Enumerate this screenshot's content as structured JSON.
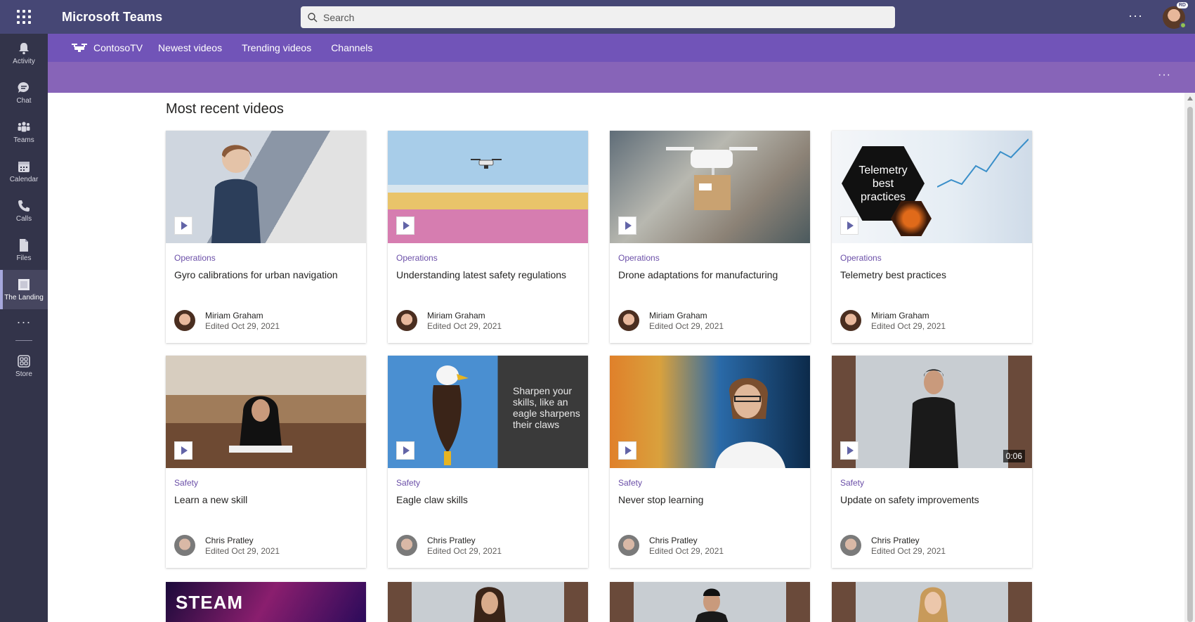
{
  "app": {
    "title": "Microsoft Teams"
  },
  "search": {
    "placeholder": "Search"
  },
  "rail": [
    {
      "label": "Activity",
      "icon": "bell-icon"
    },
    {
      "label": "Chat",
      "icon": "chat-icon"
    },
    {
      "label": "Teams",
      "icon": "teams-icon"
    },
    {
      "label": "Calendar",
      "icon": "calendar-icon"
    },
    {
      "label": "Calls",
      "icon": "phone-icon"
    },
    {
      "label": "Files",
      "icon": "file-icon"
    },
    {
      "label": "The Landing",
      "icon": "landing-icon",
      "active": true
    }
  ],
  "rail_store": {
    "label": "Store",
    "icon": "store-icon"
  },
  "user": {
    "initials": "RD"
  },
  "nav": {
    "brand": "ContosoTV",
    "links": [
      "Newest videos",
      "Trending videos",
      "Channels"
    ]
  },
  "section": {
    "title": "Most recent videos"
  },
  "videos": [
    {
      "category": "Operations",
      "title": "Gyro calibrations for urban navigation",
      "author": "Miriam Graham",
      "edited": "Edited Oct 29, 2021"
    },
    {
      "category": "Operations",
      "title": "Understanding latest safety regulations",
      "author": "Miriam Graham",
      "edited": "Edited Oct 29, 2021"
    },
    {
      "category": "Operations",
      "title": "Drone adaptations for manufacturing",
      "author": "Miriam Graham",
      "edited": "Edited Oct 29, 2021"
    },
    {
      "category": "Operations",
      "title": "Telemetry best practices",
      "author": "Miriam Graham",
      "edited": "Edited Oct 29, 2021",
      "thumb_text": [
        "Telemetry",
        "best",
        "practices"
      ]
    },
    {
      "category": "Safety",
      "title": "Learn a new skill",
      "author": "Chris Pratley",
      "edited": "Edited Oct 29, 2021"
    },
    {
      "category": "Safety",
      "title": "Eagle claw skills",
      "author": "Chris Pratley",
      "edited": "Edited Oct 29, 2021",
      "thumb_text": [
        "Sharpen your",
        "skills, like an",
        "eagle sharpens",
        "their claws"
      ]
    },
    {
      "category": "Safety",
      "title": "Never stop learning",
      "author": "Chris Pratley",
      "edited": "Edited Oct 29, 2021"
    },
    {
      "category": "Safety",
      "title": "Update on safety improvements",
      "author": "Chris Pratley",
      "edited": "Edited Oct 29, 2021",
      "duration": "0:06"
    }
  ],
  "partial_row": {
    "first_thumb_text": "STEAM"
  },
  "colors": {
    "titlebar": "#464775",
    "rail": "#33344a",
    "nav": "#7154b8",
    "subbar": "#8764b8",
    "category": "#6b4fa8"
  }
}
